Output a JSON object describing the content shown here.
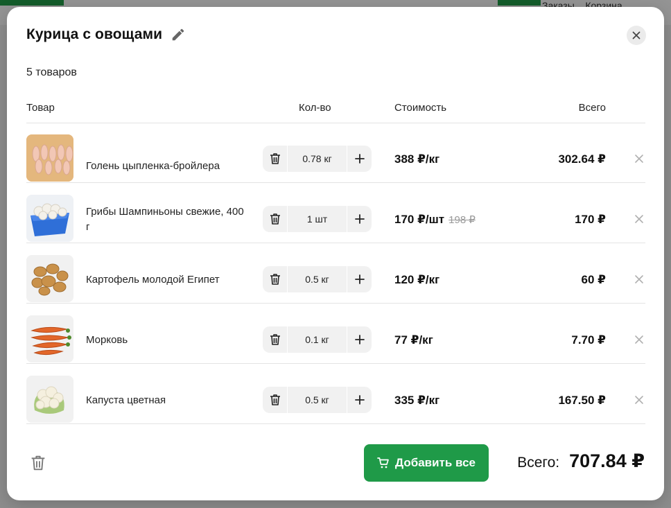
{
  "background": {
    "nav_orders": "Заказы",
    "nav_cart": "Корзина"
  },
  "modal": {
    "title": "Курица с овощами",
    "item_count": "5 товаров",
    "columns": {
      "item": "Товар",
      "qty": "Кол-во",
      "price": "Стоимость",
      "total": "Всего"
    },
    "items": [
      {
        "name": "Голень цыпленка-бройлера",
        "qty": "0.78 кг",
        "price": "388 ₽/кг",
        "old_price": "",
        "total": "302.64 ₽",
        "thumb": "chicken-drumsticks"
      },
      {
        "name": "Грибы Шампиньоны свежие, 400 г",
        "qty": "1 шт",
        "price": "170 ₽/шт",
        "old_price": "198 ₽",
        "total": "170 ₽",
        "thumb": "mushrooms"
      },
      {
        "name": "Картофель молодой Египет",
        "qty": "0.5 кг",
        "price": "120 ₽/кг",
        "old_price": "",
        "total": "60 ₽",
        "thumb": "potatoes"
      },
      {
        "name": "Морковь",
        "qty": "0.1 кг",
        "price": "77 ₽/кг",
        "old_price": "",
        "total": "7.70 ₽",
        "thumb": "carrots"
      },
      {
        "name": "Капуста цветная",
        "qty": "0.5 кг",
        "price": "335 ₽/кг",
        "old_price": "",
        "total": "167.50 ₽",
        "thumb": "cauliflower"
      }
    ],
    "footer": {
      "add_all_label": "Добавить все",
      "total_label": "Всего:",
      "total_value": "707.84 ₽"
    }
  },
  "colors": {
    "accent_green": "#1f9a48",
    "stepper_bg": "#f1f1f1",
    "divider": "#e3e3e3"
  }
}
